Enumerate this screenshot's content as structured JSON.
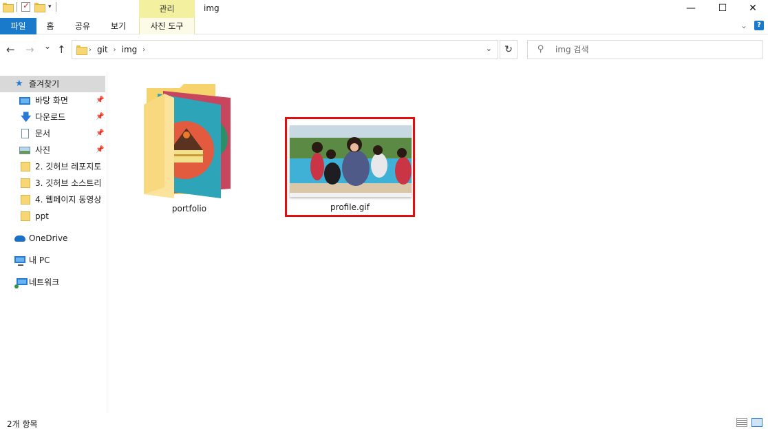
{
  "window": {
    "title": "img",
    "context_tab": "관리",
    "minimize": "—",
    "maximize": "☐",
    "close": "✕"
  },
  "ribbon": {
    "tabs": [
      "파일",
      "홈",
      "공유",
      "보기",
      "사진 도구"
    ],
    "help": "?"
  },
  "nav": {
    "back": "←",
    "forward": "→",
    "recent": "⌄",
    "up": "↑",
    "breadcrumbs": [
      "git",
      "img"
    ],
    "refresh": "↻",
    "search_placeholder": "img 검색"
  },
  "sidebar": {
    "items": [
      {
        "label": "즐겨찾기",
        "pinned": false
      },
      {
        "label": "바탕 화면",
        "pinned": true
      },
      {
        "label": "다운로드",
        "pinned": true
      },
      {
        "label": "문서",
        "pinned": true
      },
      {
        "label": "사진",
        "pinned": true
      },
      {
        "label": "2. 깃허브 레포지토",
        "pinned": false
      },
      {
        "label": "3. 깃허브 소스트리",
        "pinned": false
      },
      {
        "label": "4. 웹페이지 동영상",
        "pinned": false
      },
      {
        "label": "ppt",
        "pinned": false
      },
      {
        "label": "OneDrive",
        "pinned": false
      },
      {
        "label": "내 PC",
        "pinned": false
      },
      {
        "label": "네트워크",
        "pinned": false
      }
    ]
  },
  "files": [
    {
      "name": "portfolio",
      "type": "folder"
    },
    {
      "name": "profile.gif",
      "type": "image",
      "selected_highlight": "#e01010"
    }
  ],
  "status": {
    "count_text": "2개 항목"
  },
  "colors": {
    "accent": "#1979ca",
    "manage_tab": "#f3f0a0",
    "highlight_border": "#e01010"
  }
}
